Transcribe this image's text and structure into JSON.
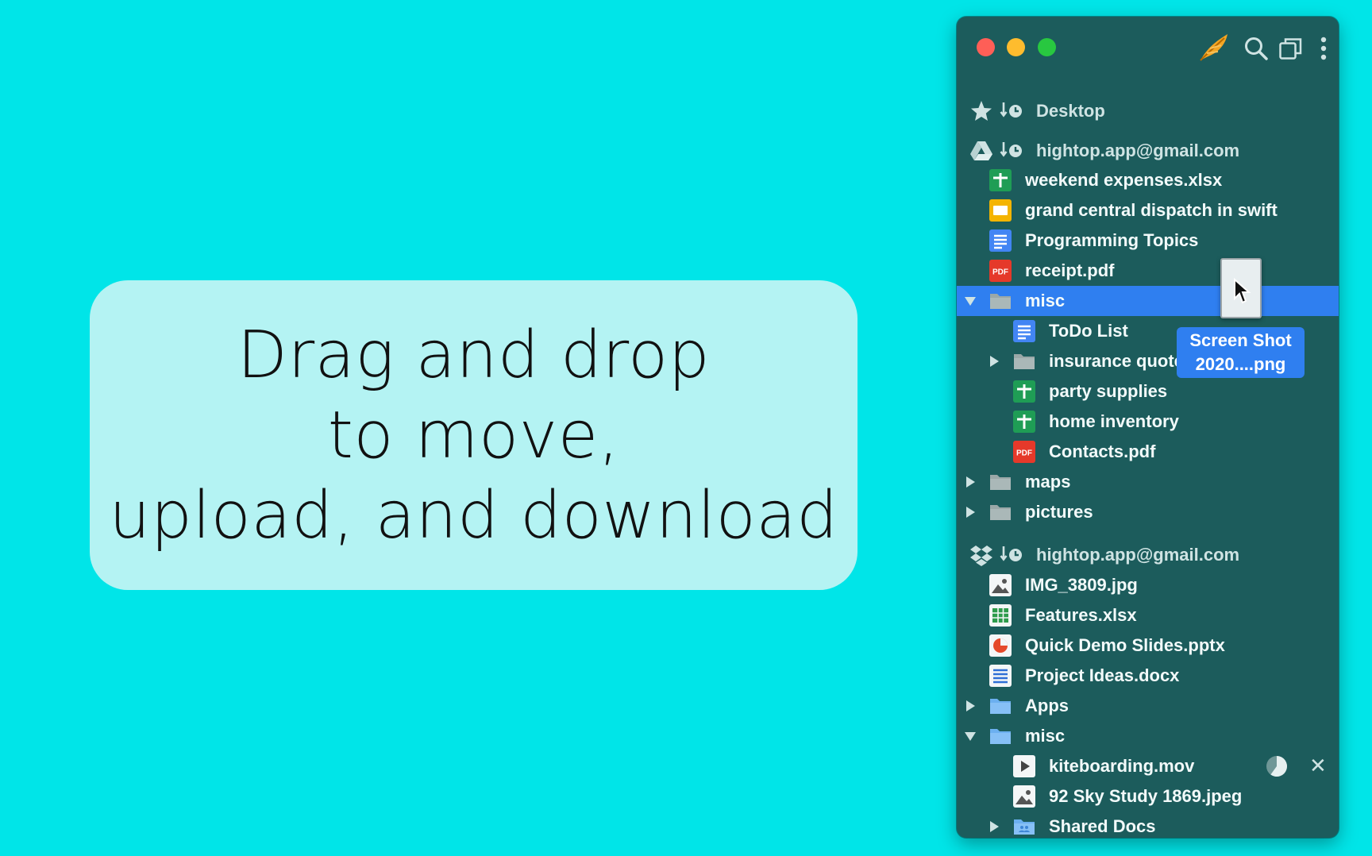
{
  "promo": {
    "line1": "Drag and drop",
    "line2": "to move,",
    "line3": "upload, and download"
  },
  "window": {
    "toolbar_icons": [
      "feather-icon",
      "search-icon",
      "new-window-icon",
      "more-icon"
    ],
    "favorites": {
      "label": "Desktop",
      "icon": "star-icon"
    },
    "google_drive": {
      "account": "hightop.app@gmail.com",
      "items": [
        {
          "name": "weekend expenses.xlsx",
          "icon": "sheets-icon"
        },
        {
          "name": "grand central dispatch in swift",
          "icon": "slides-icon"
        },
        {
          "name": "Programming Topics",
          "icon": "docs-icon"
        },
        {
          "name": "receipt.pdf",
          "icon": "pdf-icon"
        },
        {
          "name": "misc",
          "icon": "folder-icon",
          "expanded": true,
          "selected": true
        },
        {
          "name": "ToDo List",
          "icon": "docs-icon"
        },
        {
          "name": "insurance quotes",
          "icon": "folder-icon",
          "expanded": false
        },
        {
          "name": "party supplies",
          "icon": "sheets-icon"
        },
        {
          "name": "home inventory",
          "icon": "sheets-icon"
        },
        {
          "name": "Contacts.pdf",
          "icon": "pdf-icon"
        },
        {
          "name": "maps",
          "icon": "folder-icon",
          "expanded": false
        },
        {
          "name": "pictures",
          "icon": "folder-icon",
          "expanded": false
        }
      ]
    },
    "dropbox": {
      "account": "hightop.app@gmail.com",
      "items": [
        {
          "name": "IMG_3809.jpg",
          "icon": "image-icon"
        },
        {
          "name": "Features.xlsx",
          "icon": "spreadsheet-icon"
        },
        {
          "name": "Quick Demo Slides.pptx",
          "icon": "presentation-icon"
        },
        {
          "name": "Project Ideas.docx",
          "icon": "document-icon"
        },
        {
          "name": "Apps",
          "icon": "folder-icon",
          "expanded": false
        },
        {
          "name": "misc",
          "icon": "folder-icon",
          "expanded": true
        },
        {
          "name": "kiteboarding.mov",
          "icon": "video-icon",
          "upload_progress": 0.6
        },
        {
          "name": "92 Sky Study 1869.jpeg",
          "icon": "image-icon"
        },
        {
          "name": "Shared Docs",
          "icon": "shared-folder-icon",
          "expanded": false
        }
      ]
    },
    "drag": {
      "line1": "Screen Shot",
      "line2": "2020....png"
    }
  },
  "colors": {
    "background": "#00e5e8",
    "window": "#1c5c5c",
    "selection": "#2f7ff0"
  }
}
